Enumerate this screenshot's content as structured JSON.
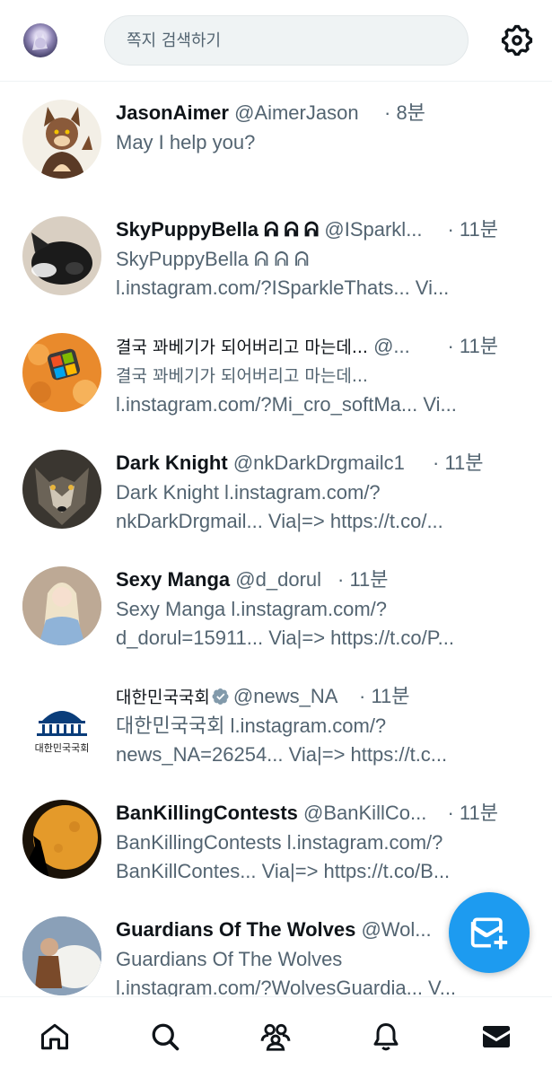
{
  "search": {
    "placeholder": "쪽지 검색하기"
  },
  "conversations": [
    {
      "name": "JasonAimer",
      "handle": "@AimerJason",
      "time": "· 8분",
      "line1": "May I help you?",
      "line2": ""
    },
    {
      "name": "SkyPuppyBella ᕱ ᕱ ᕱ",
      "handle": "@ISparkl...",
      "time": "· 11분",
      "line1": "SkyPuppyBella ᕱ ᕱ ᕱ",
      "line2": "l.instagram.com/?ISparkleThats... Vi..."
    },
    {
      "name": "결국 꽈베기가 되어버리고 마는데...",
      "handle": "@...",
      "time": "· 11분",
      "line1": "결국 꽈베기가 되어버리고 마는데...",
      "line2": "l.instagram.com/?Mi_cro_softMa... Vi..."
    },
    {
      "name": "Dark Knight",
      "handle": "@nkDarkDrgmailc1",
      "time": "· 11분",
      "line1": "Dark Knight l.instagram.com/?",
      "line2": "nkDarkDrgmail... Via|=> https://t.co/..."
    },
    {
      "name": "Sexy Manga",
      "handle": "@d_dorul",
      "time": "· 11분",
      "line1": "Sexy Manga l.instagram.com/?",
      "line2": "d_dorul=15911... Via|=> https://t.co/P..."
    },
    {
      "name": "대한민국국회",
      "handle": "@news_NA",
      "time": "· 11분",
      "line1": "대한민국국회 l.instagram.com/?",
      "line2": "news_NA=26254... Via|=> https://t.c...",
      "avatar_text": "대한민국국회"
    },
    {
      "name": "BanKillingContests",
      "handle": "@BanKillCo...",
      "time": "· 11분",
      "line1": "BanKillingContests l.instagram.com/?",
      "line2": "BanKillContes... Via|=> https://t.co/B..."
    },
    {
      "name": "Guardians Of The Wolves",
      "handle": "@Wol...",
      "time": "",
      "line1": "Guardians Of The Wolves",
      "line2": "l.instagram.com/?WolvesGuardia... V..."
    }
  ],
  "colors": {
    "accent": "#1d9bf0",
    "secondary_text": "#536471",
    "primary_text": "#0f1419"
  },
  "icons": [
    "settings-icon",
    "new-message-icon",
    "home-icon",
    "search-icon",
    "communities-icon",
    "notifications-icon",
    "messages-icon",
    "verified-icon"
  ]
}
